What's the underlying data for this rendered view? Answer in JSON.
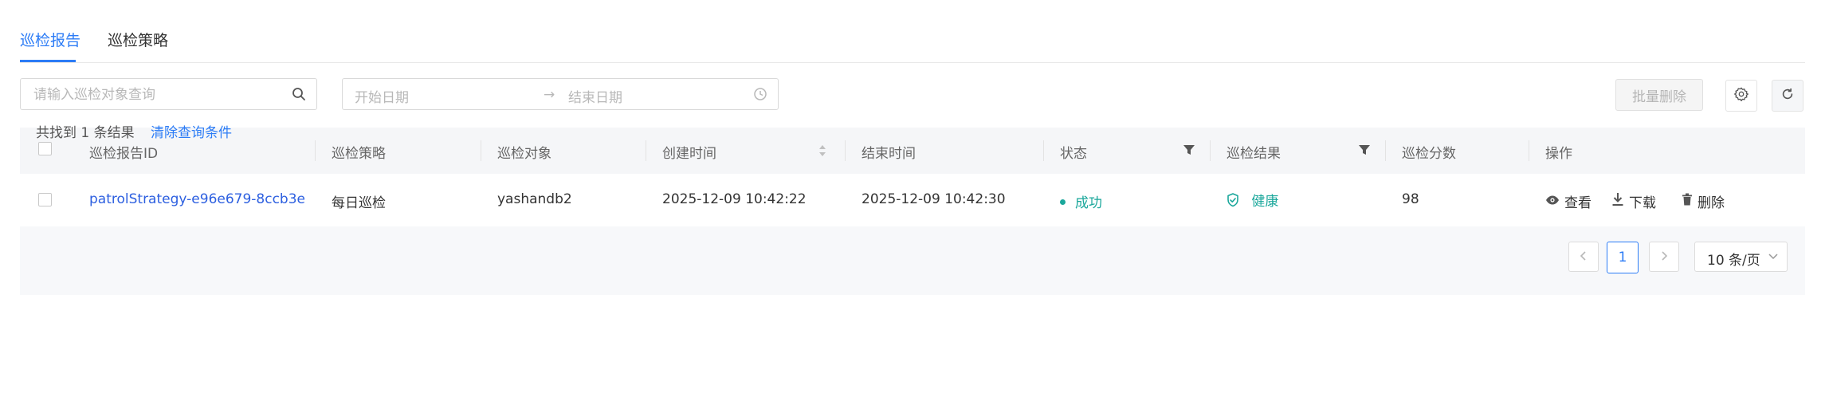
{
  "tabs": [
    {
      "label": "巡检报告",
      "active": true
    },
    {
      "label": "巡检策略",
      "active": false
    }
  ],
  "toolbar": {
    "search_placeholder": "请输入巡检对象查询",
    "start_date_placeholder": "开始日期",
    "end_date_placeholder": "结束日期",
    "date_separator": "→",
    "batch_delete_label": "批量删除",
    "icons": {
      "settings": "gear-icon",
      "refresh": "refresh-icon",
      "search": "search-icon",
      "date": "clock-icon"
    }
  },
  "table": {
    "columns": [
      "巡检报告ID",
      "巡检策略",
      "巡检对象",
      "创建时间",
      "结束时间",
      "状态",
      "巡检结果",
      "巡检分数",
      "操作"
    ],
    "rows": [
      {
        "id": "patrolStrategy-e96e679-8ccb3e",
        "strategy": "每日巡检",
        "target": "yashandb2",
        "created": "2025-12-09 10:42:22",
        "ended": "2025-12-09 10:42:30",
        "status": "成功",
        "result": "健康",
        "score": "98",
        "actions": {
          "view": "查看",
          "download": "下载",
          "delete": "删除"
        }
      }
    ]
  },
  "footer": {
    "total_text": "共找到 1 条结果",
    "clear_label": "清除查询条件",
    "current_page": "1",
    "page_size": "10 条/页",
    "prev": "‹",
    "next": "›"
  },
  "colors": {
    "accent": "#2c7cf6",
    "success": "#1aa79b",
    "link": "#2c5fe0"
  }
}
